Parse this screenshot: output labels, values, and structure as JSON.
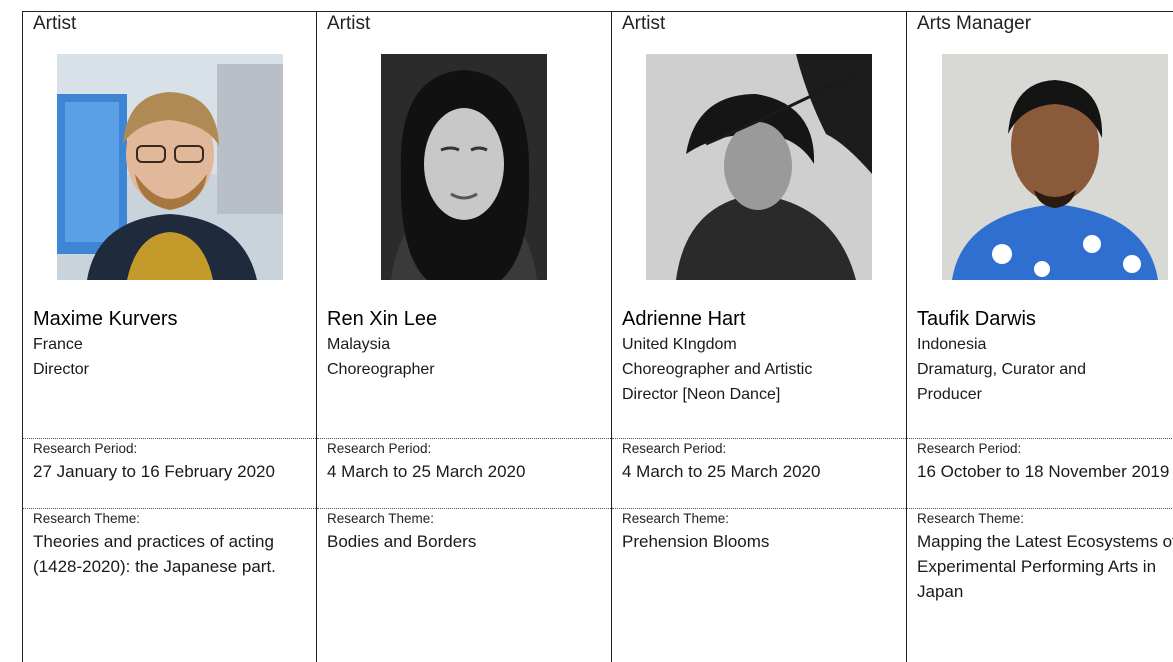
{
  "columns": [
    {
      "role": "Artist",
      "name": "Maxime Kurvers",
      "country": "France",
      "position_lines": [
        "Director"
      ],
      "period_label": "Research Period:",
      "period_value": "27 January to 16 February 2020",
      "theme_label": "Research Theme:",
      "theme_value": "Theories and practices of acting (1428-2020): the Japanese part."
    },
    {
      "role": "Artist",
      "name": "Ren Xin Lee",
      "country": "Malaysia",
      "position_lines": [
        "Choreographer"
      ],
      "period_label": "Research Period:",
      "period_value": "4 March to 25 March 2020",
      "theme_label": "Research Theme:",
      "theme_value": "Bodies and Borders"
    },
    {
      "role": "Artist",
      "name": "Adrienne Hart",
      "country": "United KIngdom",
      "position_lines": [
        "Choreographer and Artistic",
        "Director [Neon Dance]"
      ],
      "period_label": "Research Period:",
      "period_value": "4 March to 25 March 2020",
      "theme_label": "Research Theme:",
      "theme_value": "Prehension Blooms"
    },
    {
      "role": "Arts Manager",
      "name": "Taufik Darwis",
      "country": "Indonesia",
      "position_lines": [
        "Dramaturg, Curator and",
        "Producer"
      ],
      "period_label": "Research Period:",
      "period_value": "16 October to 18 November 2019",
      "theme_label": "Research Theme:",
      "theme_value": "Mapping the Latest Ecosystems of Experimental Performing Arts in Japan"
    }
  ]
}
